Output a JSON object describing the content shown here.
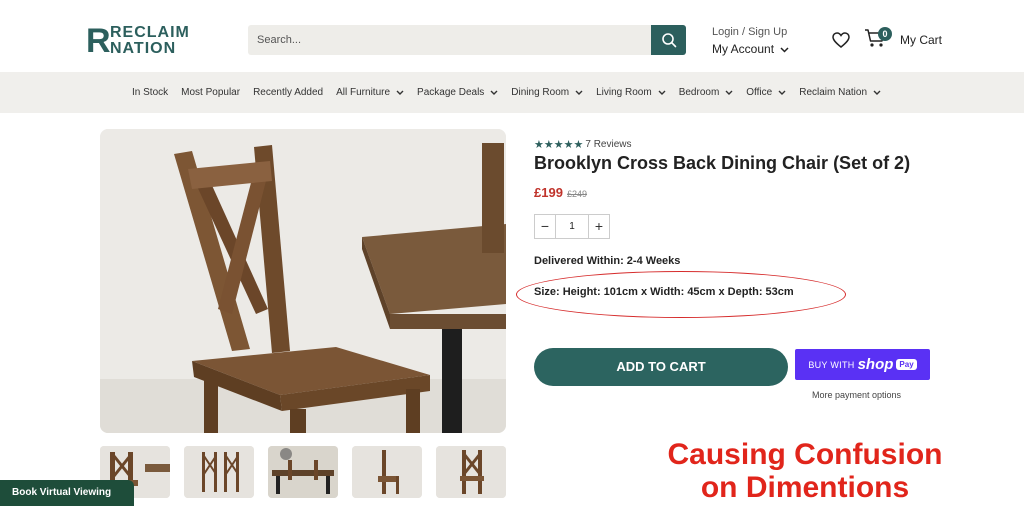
{
  "header": {
    "logo_letter": "R",
    "logo_line1": "RECLAIM",
    "logo_line2": "NATION",
    "search_placeholder": "Search...",
    "login_label": "Login / Sign Up",
    "account_label": "My Account",
    "cart_count": "0",
    "cart_label": "My Cart"
  },
  "nav": {
    "items": [
      {
        "label": "In Stock",
        "dropdown": false
      },
      {
        "label": "Most Popular",
        "dropdown": false
      },
      {
        "label": "Recently Added",
        "dropdown": false
      },
      {
        "label": "All Furniture",
        "dropdown": true
      },
      {
        "label": "Package Deals",
        "dropdown": true
      },
      {
        "label": "Dining Room",
        "dropdown": true
      },
      {
        "label": "Living Room",
        "dropdown": true
      },
      {
        "label": "Bedroom",
        "dropdown": true
      },
      {
        "label": "Office",
        "dropdown": true
      },
      {
        "label": "Reclaim Nation",
        "dropdown": true
      }
    ]
  },
  "product": {
    "rating_stars": 5,
    "reviews_label": "7 Reviews",
    "title": "Brooklyn Cross Back Dining Chair (Set of 2)",
    "price": "£199",
    "old_price": "£249",
    "quantity": "1",
    "delivery": "Delivered Within: 2-4 Weeks",
    "size": "Size: Height: 101cm x Width: 45cm x Depth: 53cm",
    "add_to_cart": "ADD TO CART",
    "buy_with": "BUY WITH",
    "shop_word": "shop",
    "pay_word": "Pay",
    "more_payment": "More payment options"
  },
  "annotation": {
    "line1": "Causing Confusion",
    "line2": "on Dimentions",
    "color": "#e1251b"
  },
  "book_viewing": "Book Virtual Viewing",
  "colors": {
    "brand": "#2c5f5d",
    "price": "#c0332b",
    "shop_pay": "#5a31f4"
  }
}
